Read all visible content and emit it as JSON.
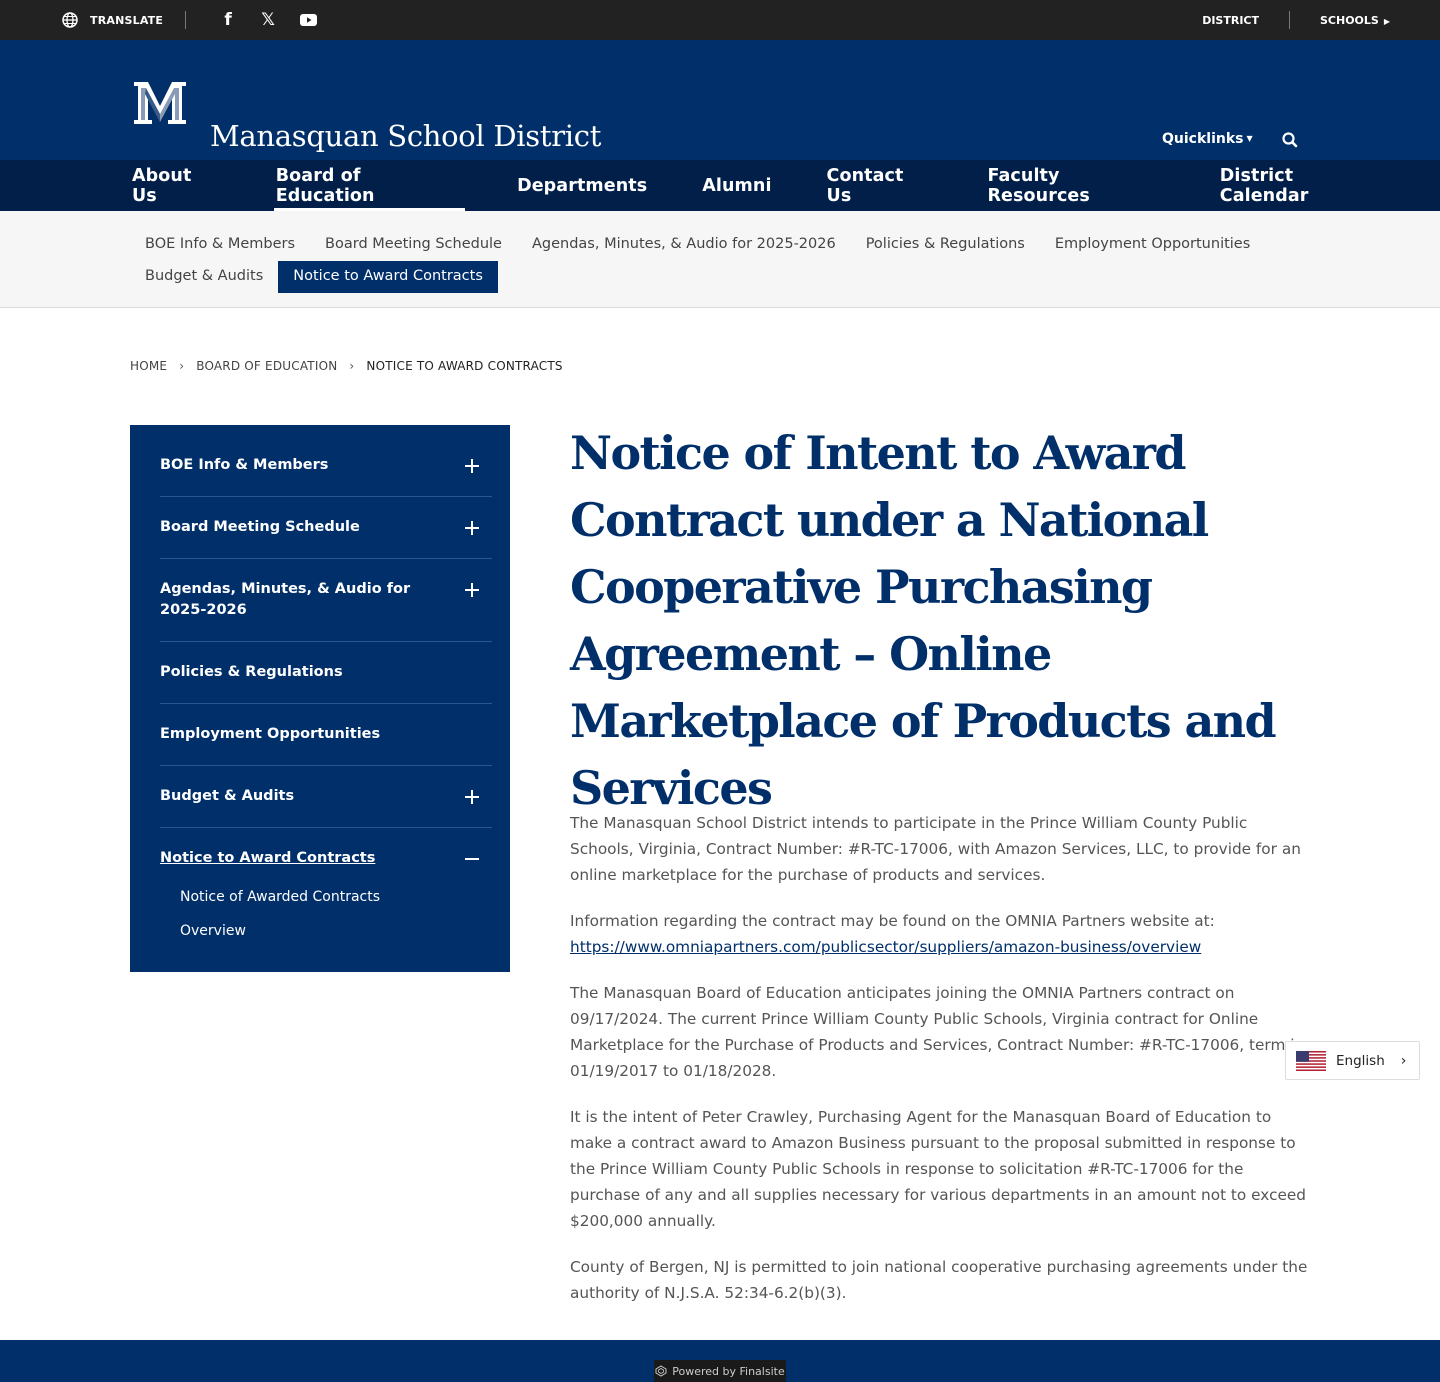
{
  "utility": {
    "translate_label": "TRANSLATE",
    "social": [
      {
        "icon": "facebook-icon",
        "glyph": "f"
      },
      {
        "icon": "x-icon",
        "glyph": "𝕏"
      },
      {
        "icon": "youtube-icon",
        "glyph": "▶"
      }
    ],
    "district_label": "DISTRICT",
    "schools_label": "SCHOOLS"
  },
  "header": {
    "site_title": "Manasquan School District",
    "quicklinks_label": "Quicklinks"
  },
  "main_nav": [
    {
      "label": "About Us"
    },
    {
      "label": "Board of Education"
    },
    {
      "label": "Departments"
    },
    {
      "label": "Alumni"
    },
    {
      "label": "Contact Us"
    },
    {
      "label": "Faculty Resources"
    },
    {
      "label": "District Calendar"
    }
  ],
  "sub_nav": [
    {
      "label": "BOE Info & Members"
    },
    {
      "label": "Board Meeting Schedule"
    },
    {
      "label": "Agendas, Minutes, & Audio for 2025-2026"
    },
    {
      "label": "Policies & Regulations"
    },
    {
      "label": "Employment Opportunities"
    },
    {
      "label": "Budget & Audits"
    },
    {
      "label": "Notice to Award Contracts"
    }
  ],
  "breadcrumb": {
    "home": "HOME",
    "section": "BOARD OF EDUCATION",
    "current": "NOTICE TO AWARD CONTRACTS"
  },
  "side_nav": {
    "items": [
      {
        "label": "BOE Info & Members",
        "toggle": "+"
      },
      {
        "label": "Board Meeting Schedule",
        "toggle": "+"
      },
      {
        "label": "Agendas, Minutes, & Audio for 2025-2026",
        "toggle": "+"
      },
      {
        "label": "Policies & Regulations"
      },
      {
        "label": "Employment Opportunities"
      },
      {
        "label": "Budget & Audits",
        "toggle": "+"
      },
      {
        "label": "Notice to Award Contracts",
        "toggle": "−"
      }
    ],
    "sub_items": [
      {
        "label": "Notice of Awarded Contracts"
      },
      {
        "label": "Overview"
      }
    ]
  },
  "content": {
    "title": "Notice of Intent to Award Contract under a National Cooperative Purchasing Agreement – Online Marketplace of Products and Services",
    "p1": "The Manasquan School District intends to participate in the Prince William County Public Schools, Virginia, Contract Number: #R-TC-17006, with Amazon Services, LLC, to provide for an online marketplace for the purchase of products and services.",
    "p2_text": "Information regarding the contract may be found on the OMNIA Partners website at:",
    "p2_link": "https://www.omniapartners.com/publicsector/suppliers/amazon-business/overview",
    "p3": "The Manasquan Board of Education anticipates joining the OMNIA Partners contract on 09/17/2024. The current Prince William County Public Schools, Virginia contract for Online Marketplace for the Purchase of Products and Services, Contract Number: #R-TC-17006, term is 01/19/2017 to 01/18/2028.",
    "p4": "It is the intent of Peter Crawley, Purchasing Agent for the Manasquan Board of Education to make a contract award to Amazon Business pursuant to the proposal submitted in response to the Prince William County Public Schools in response to solicitation #R-TC-17006 for the purchase of  any and all supplies necessary for various departments in an amount not to exceed $200,000 annually.",
    "p5": "County of Bergen, NJ is permitted to join national cooperative purchasing agreements under the authority of N.J.S.A. 52:34-6.2(b)(3)."
  },
  "language": {
    "selected": "English"
  },
  "footer": {
    "powered_by": "Powered by Finalsite"
  }
}
